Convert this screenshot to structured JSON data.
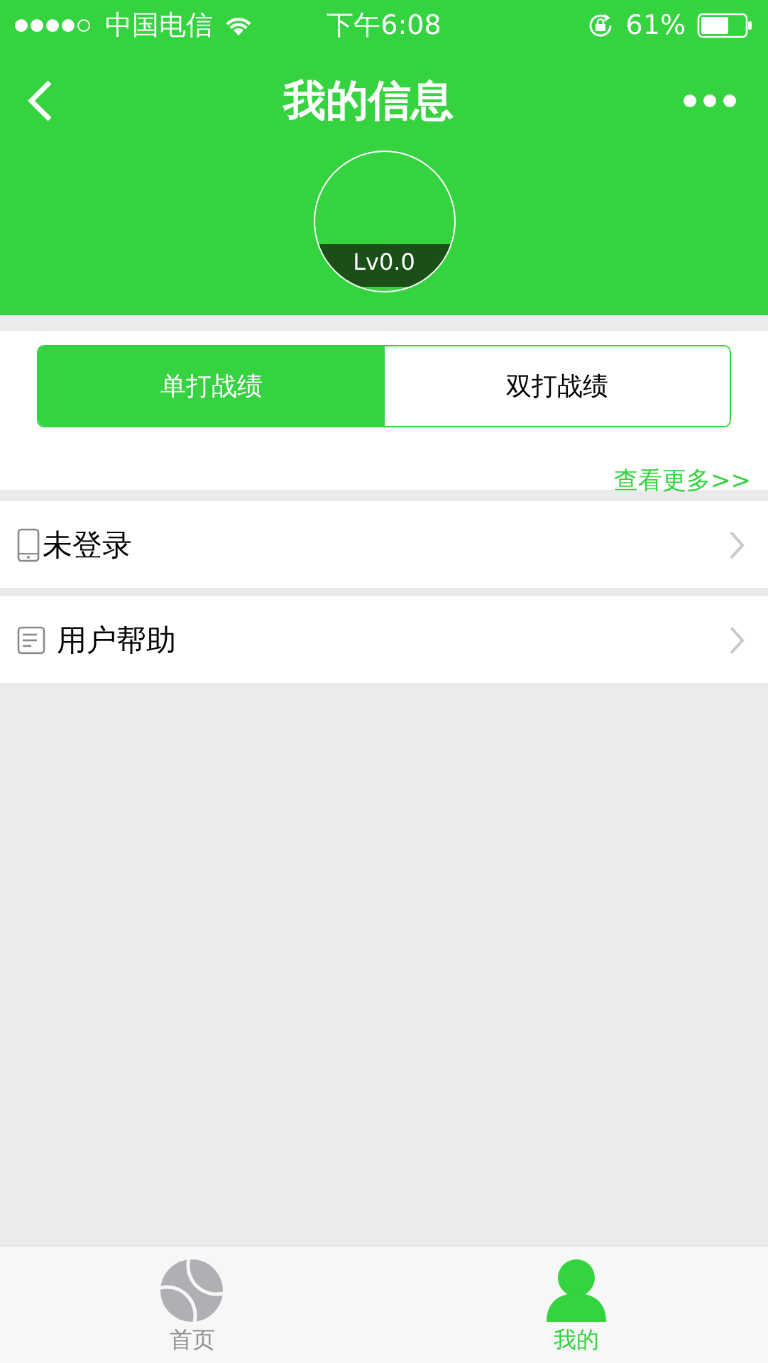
{
  "status_bar": {
    "carrier": "中国电信",
    "time": "下午6:08",
    "battery": "61%"
  },
  "nav": {
    "title": "我的信息"
  },
  "profile": {
    "level_label": "Lv0.0"
  },
  "segments": [
    {
      "label": "单打战绩",
      "selected": true
    },
    {
      "label": "双打战绩",
      "selected": false
    }
  ],
  "more_link": "查看更多>>",
  "menu": [
    {
      "label": "未登录",
      "kind": "phone"
    },
    {
      "label": "用户帮助",
      "kind": "document"
    }
  ],
  "tab_bar": [
    {
      "label": "首页",
      "kind": "ball",
      "selected": false
    },
    {
      "label": "我的",
      "kind": "person",
      "selected": true
    }
  ]
}
